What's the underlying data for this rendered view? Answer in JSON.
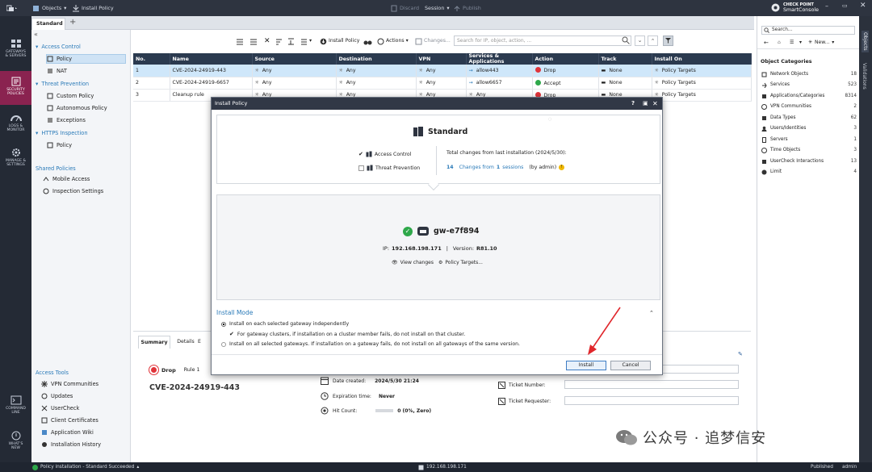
{
  "titlebar": {
    "menu_label": "Objects",
    "install_label": "Install Policy",
    "discard_label": "Discard",
    "session_label": "Session",
    "publish_label": "Publish",
    "brand_line1": "CHECK POINT",
    "brand_line2": "SmartConsole"
  },
  "rail": {
    "items": [
      {
        "label1": "GATEWAYS",
        "label2": "& SERVERS"
      },
      {
        "label1": "SECURITY",
        "label2": "POLICIES"
      },
      {
        "label1": "LOGS &",
        "label2": "MONITOR"
      },
      {
        "label1": "MANAGE &",
        "label2": "SETTINGS"
      },
      {
        "label1": "COMMAND",
        "label2": "LINE"
      },
      {
        "label1": "WHAT'S",
        "label2": "NEW"
      }
    ]
  },
  "tabs": {
    "active": "Standard"
  },
  "nav": {
    "collapse": "«",
    "access_control": "Access Control",
    "policy": "Policy",
    "nat": "NAT",
    "threat_prevention": "Threat Prevention",
    "custom_policy": "Custom Policy",
    "autonomous_policy": "Autonomous Policy",
    "exceptions": "Exceptions",
    "https_inspection": "HTTPS Inspection",
    "https_policy": "Policy",
    "shared_policies": "Shared Policies",
    "mobile_access": "Mobile Access",
    "inspection_settings": "Inspection Settings",
    "access_tools": "Access Tools",
    "tools": [
      "VPN Communities",
      "Updates",
      "UserCheck",
      "Client Certificates",
      "Application Wiki",
      "Installation History"
    ]
  },
  "toolbar": {
    "install_policy": "Install Policy",
    "actions": "Actions",
    "changes": "Changes...",
    "search_placeholder": "Search for IP, object, action, ..."
  },
  "table": {
    "columns": [
      "No.",
      "Name",
      "Source",
      "Destination",
      "VPN",
      "Services & Applications",
      "Action",
      "Track",
      "Install On"
    ],
    "rows": [
      {
        "no": "1",
        "name": "CVE-2024-24919-443",
        "source": "Any",
        "destination": "Any",
        "vpn": "Any",
        "service": "allow443",
        "action": "Drop",
        "track": "None",
        "install_on": "Policy Targets"
      },
      {
        "no": "2",
        "name": "CVE-2024-24919-6657",
        "source": "Any",
        "destination": "Any",
        "vpn": "Any",
        "service": "allow6657",
        "action": "Accept",
        "track": "None",
        "install_on": "Policy Targets"
      },
      {
        "no": "3",
        "name": "Cleanup rule",
        "source": "Any",
        "destination": "Any",
        "vpn": "Any",
        "service": "Any",
        "action": "Drop",
        "track": "None",
        "install_on": "Policy Targets"
      }
    ]
  },
  "bottom": {
    "tab_summary": "Summary",
    "tab_details": "Details",
    "action": "Drop",
    "rule": "Rule 1",
    "rule_name": "CVE-2024-24919-443",
    "date_created_label": "Date created:",
    "date_created_value": "2024/5/30 21:24",
    "expiration_label": "Expiration time:",
    "expiration_value": "Never",
    "hit_label": "Hit Count:",
    "hit_value": "0 (0%, Zero)",
    "ticket_number_label": "Ticket Number:",
    "ticket_requester_label": "Ticket Requester:"
  },
  "right": {
    "search_placeholder": "Search...",
    "new_label": "New...",
    "categories_title": "Object Categories",
    "categories": [
      {
        "name": "Network Objects",
        "count": "18"
      },
      {
        "name": "Services",
        "count": "523"
      },
      {
        "name": "Applications/Categories",
        "count": "8314"
      },
      {
        "name": "VPN Communities",
        "count": "2"
      },
      {
        "name": "Data Types",
        "count": "62"
      },
      {
        "name": "Users/Identities",
        "count": "3"
      },
      {
        "name": "Servers",
        "count": "1"
      },
      {
        "name": "Time Objects",
        "count": "3"
      },
      {
        "name": "UserCheck Interactions",
        "count": "13"
      },
      {
        "name": "Limit",
        "count": "4"
      }
    ],
    "side_tab_objects": "Objects",
    "side_tab_validations": "Validations"
  },
  "status": {
    "message": "Policy installation - Standard Succeeded",
    "ip": "192.168.198.171",
    "published": "Published",
    "user": "admin"
  },
  "dialog": {
    "title": "Install Policy",
    "package": "Standard",
    "access_control": "Access Control",
    "threat_prevention": "Threat Prevention",
    "total_changes": "Total changes from last installation (2024/5/30):",
    "changes_count": "14",
    "changes_from": "Changes from",
    "sessions_count": "1",
    "sessions": "sessions",
    "by_admin": "(by admin)",
    "gateway": "gw-e7f894",
    "ip_label": "IP:",
    "ip": "192.168.198.171",
    "version_label": "Version:",
    "version": "R81.10",
    "view_changes": "View changes",
    "policy_targets": "Policy Targets...",
    "install_mode": "Install Mode",
    "option1": "Install on each selected gateway independently",
    "sub_option": "For gateway clusters, if installation on a cluster member fails, do not install on that cluster.",
    "option2": "Install on all selected gateways. If installation on a gateway fails, do not install on all gateways of the same version.",
    "install_btn": "Install",
    "cancel_btn": "Cancel"
  },
  "watermark": "公众号 · 追梦信安",
  "colors": {
    "accent": "#2a7ab8",
    "rail_active": "#8a2350",
    "header": "#2b3a4f",
    "success": "#2ea84a",
    "drop": "#e0343a"
  }
}
